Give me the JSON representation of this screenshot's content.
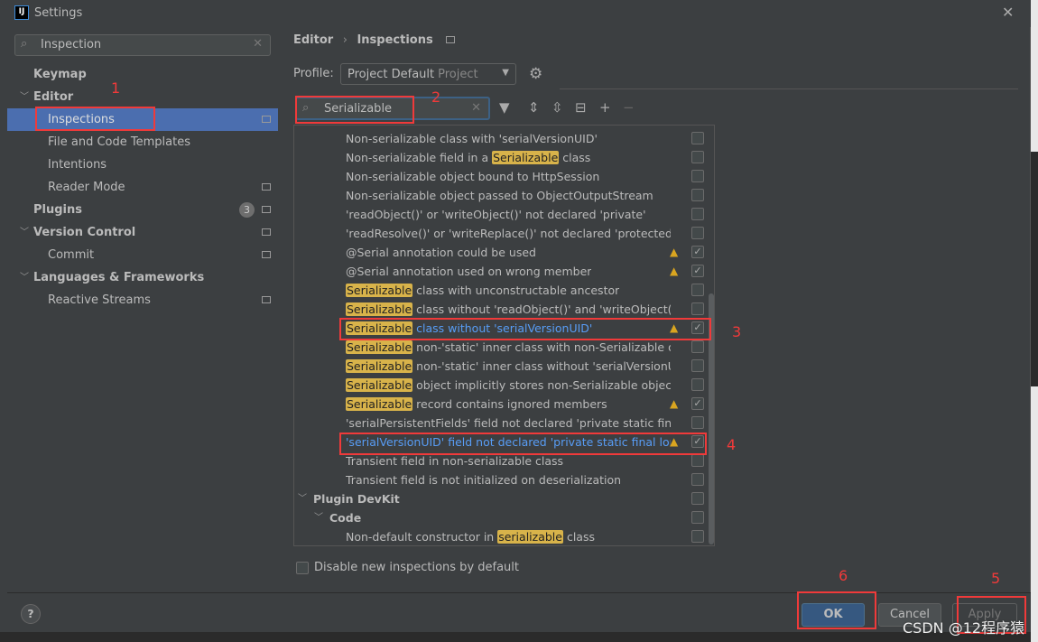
{
  "window": {
    "title": "Settings",
    "app_icon": "IJ"
  },
  "sidebar": {
    "search": {
      "value": "Inspection"
    },
    "items": [
      {
        "label": "Keymap",
        "level": 0,
        "bold": true
      },
      {
        "label": "Editor",
        "level": 0,
        "bold": true,
        "expanded": true
      },
      {
        "label": "Inspections",
        "level": 1,
        "selected": true,
        "page_icon": true
      },
      {
        "label": "File and Code Templates",
        "level": 1
      },
      {
        "label": "Intentions",
        "level": 1
      },
      {
        "label": "Reader Mode",
        "level": 1,
        "page_icon": true
      },
      {
        "label": "Plugins",
        "level": 0,
        "bold": true,
        "badge": "3",
        "page_icon": true
      },
      {
        "label": "Version Control",
        "level": 0,
        "bold": true,
        "expanded": true,
        "page_icon": true
      },
      {
        "label": "Commit",
        "level": 1,
        "page_icon": true
      },
      {
        "label": "Languages & Frameworks",
        "level": 0,
        "bold": true,
        "expanded": true
      },
      {
        "label": "Reactive Streams",
        "level": 1,
        "page_icon": true
      }
    ]
  },
  "breadcrumb": {
    "parent": "Editor",
    "sep": "›",
    "current": "Inspections"
  },
  "profile": {
    "label": "Profile:",
    "value": "Project Default",
    "scope": "Project"
  },
  "inspection_search": {
    "value": "Serializable"
  },
  "inspections": [
    {
      "parts": [
        [
          "Non-serializable class with 'serialVersionUID'",
          0
        ]
      ],
      "checked": false
    },
    {
      "parts": [
        [
          "Non-serializable field in a ",
          0
        ],
        [
          "Serializable",
          1
        ],
        [
          " class",
          0
        ]
      ],
      "checked": false
    },
    {
      "parts": [
        [
          "Non-serializable object bound to HttpSession",
          0
        ]
      ],
      "checked": false
    },
    {
      "parts": [
        [
          "Non-serializable object passed to ObjectOutputStream",
          0
        ]
      ],
      "checked": false
    },
    {
      "parts": [
        [
          "'readObject()' or 'writeObject()' not declared 'private'",
          0
        ]
      ],
      "checked": false
    },
    {
      "parts": [
        [
          "'readResolve()' or 'writeReplace()' not declared 'protected'",
          0
        ]
      ],
      "checked": false
    },
    {
      "parts": [
        [
          "@Serial annotation could be used",
          0
        ]
      ],
      "warning": true,
      "checked": true
    },
    {
      "parts": [
        [
          "@Serial annotation used on wrong member",
          0
        ]
      ],
      "warning": true,
      "checked": true
    },
    {
      "parts": [
        [
          "Serializable",
          1
        ],
        [
          " class with unconstructable ancestor",
          0
        ]
      ],
      "checked": false
    },
    {
      "parts": [
        [
          "Serializable",
          1
        ],
        [
          " class without 'readObject()' and 'writeObject()'",
          0
        ]
      ],
      "checked": false
    },
    {
      "parts": [
        [
          "Serializable",
          1
        ],
        [
          " class without 'serialVersionUID'",
          0
        ]
      ],
      "warning": true,
      "checked": true,
      "modified": true
    },
    {
      "parts": [
        [
          "Serializable",
          1
        ],
        [
          " non-'static' inner class with non-Serializable outer",
          0
        ]
      ],
      "checked": false
    },
    {
      "parts": [
        [
          "Serializable",
          1
        ],
        [
          " non-'static' inner class without 'serialVersionUID'",
          0
        ]
      ],
      "checked": false
    },
    {
      "parts": [
        [
          "Serializable",
          1
        ],
        [
          " object implicitly stores non-Serializable object",
          0
        ]
      ],
      "checked": false
    },
    {
      "parts": [
        [
          "Serializable",
          1
        ],
        [
          " record contains ignored members",
          0
        ]
      ],
      "warning": true,
      "checked": true
    },
    {
      "parts": [
        [
          "'serialPersistentFields' field not declared 'private static final O",
          0
        ]
      ],
      "checked": false
    },
    {
      "parts": [
        [
          "'serialVersionUID' field not declared 'private static final long'",
          0
        ]
      ],
      "warning": true,
      "checked": true,
      "modified": true
    },
    {
      "parts": [
        [
          "Transient field in non-serializable class",
          0
        ]
      ],
      "checked": false
    },
    {
      "parts": [
        [
          "Transient field is not initialized on deserialization",
          0
        ]
      ],
      "checked": false
    },
    {
      "parts": [
        [
          "Plugin DevKit",
          0
        ]
      ],
      "group": 1,
      "checked": false
    },
    {
      "parts": [
        [
          "Code",
          0
        ]
      ],
      "group": 2,
      "checked": false
    },
    {
      "parts": [
        [
          "Non-default constructor in ",
          0
        ],
        [
          "serializable",
          1
        ],
        [
          " class",
          0
        ]
      ],
      "checked": false
    }
  ],
  "disable_new": {
    "label": "Disable new inspections by default",
    "checked": false
  },
  "buttons": {
    "help": "?",
    "ok": "OK",
    "cancel": "Cancel",
    "apply": "Apply"
  },
  "annotations": [
    "1",
    "2",
    "3",
    "4",
    "5",
    "6"
  ],
  "watermark": "CSDN @12程序猿",
  "colors": {
    "selection": "#4b6eaf",
    "highlight": "#d8b34a",
    "modified": "#589df6",
    "warning": "#d9a520",
    "annotation": "#f03a3a"
  }
}
